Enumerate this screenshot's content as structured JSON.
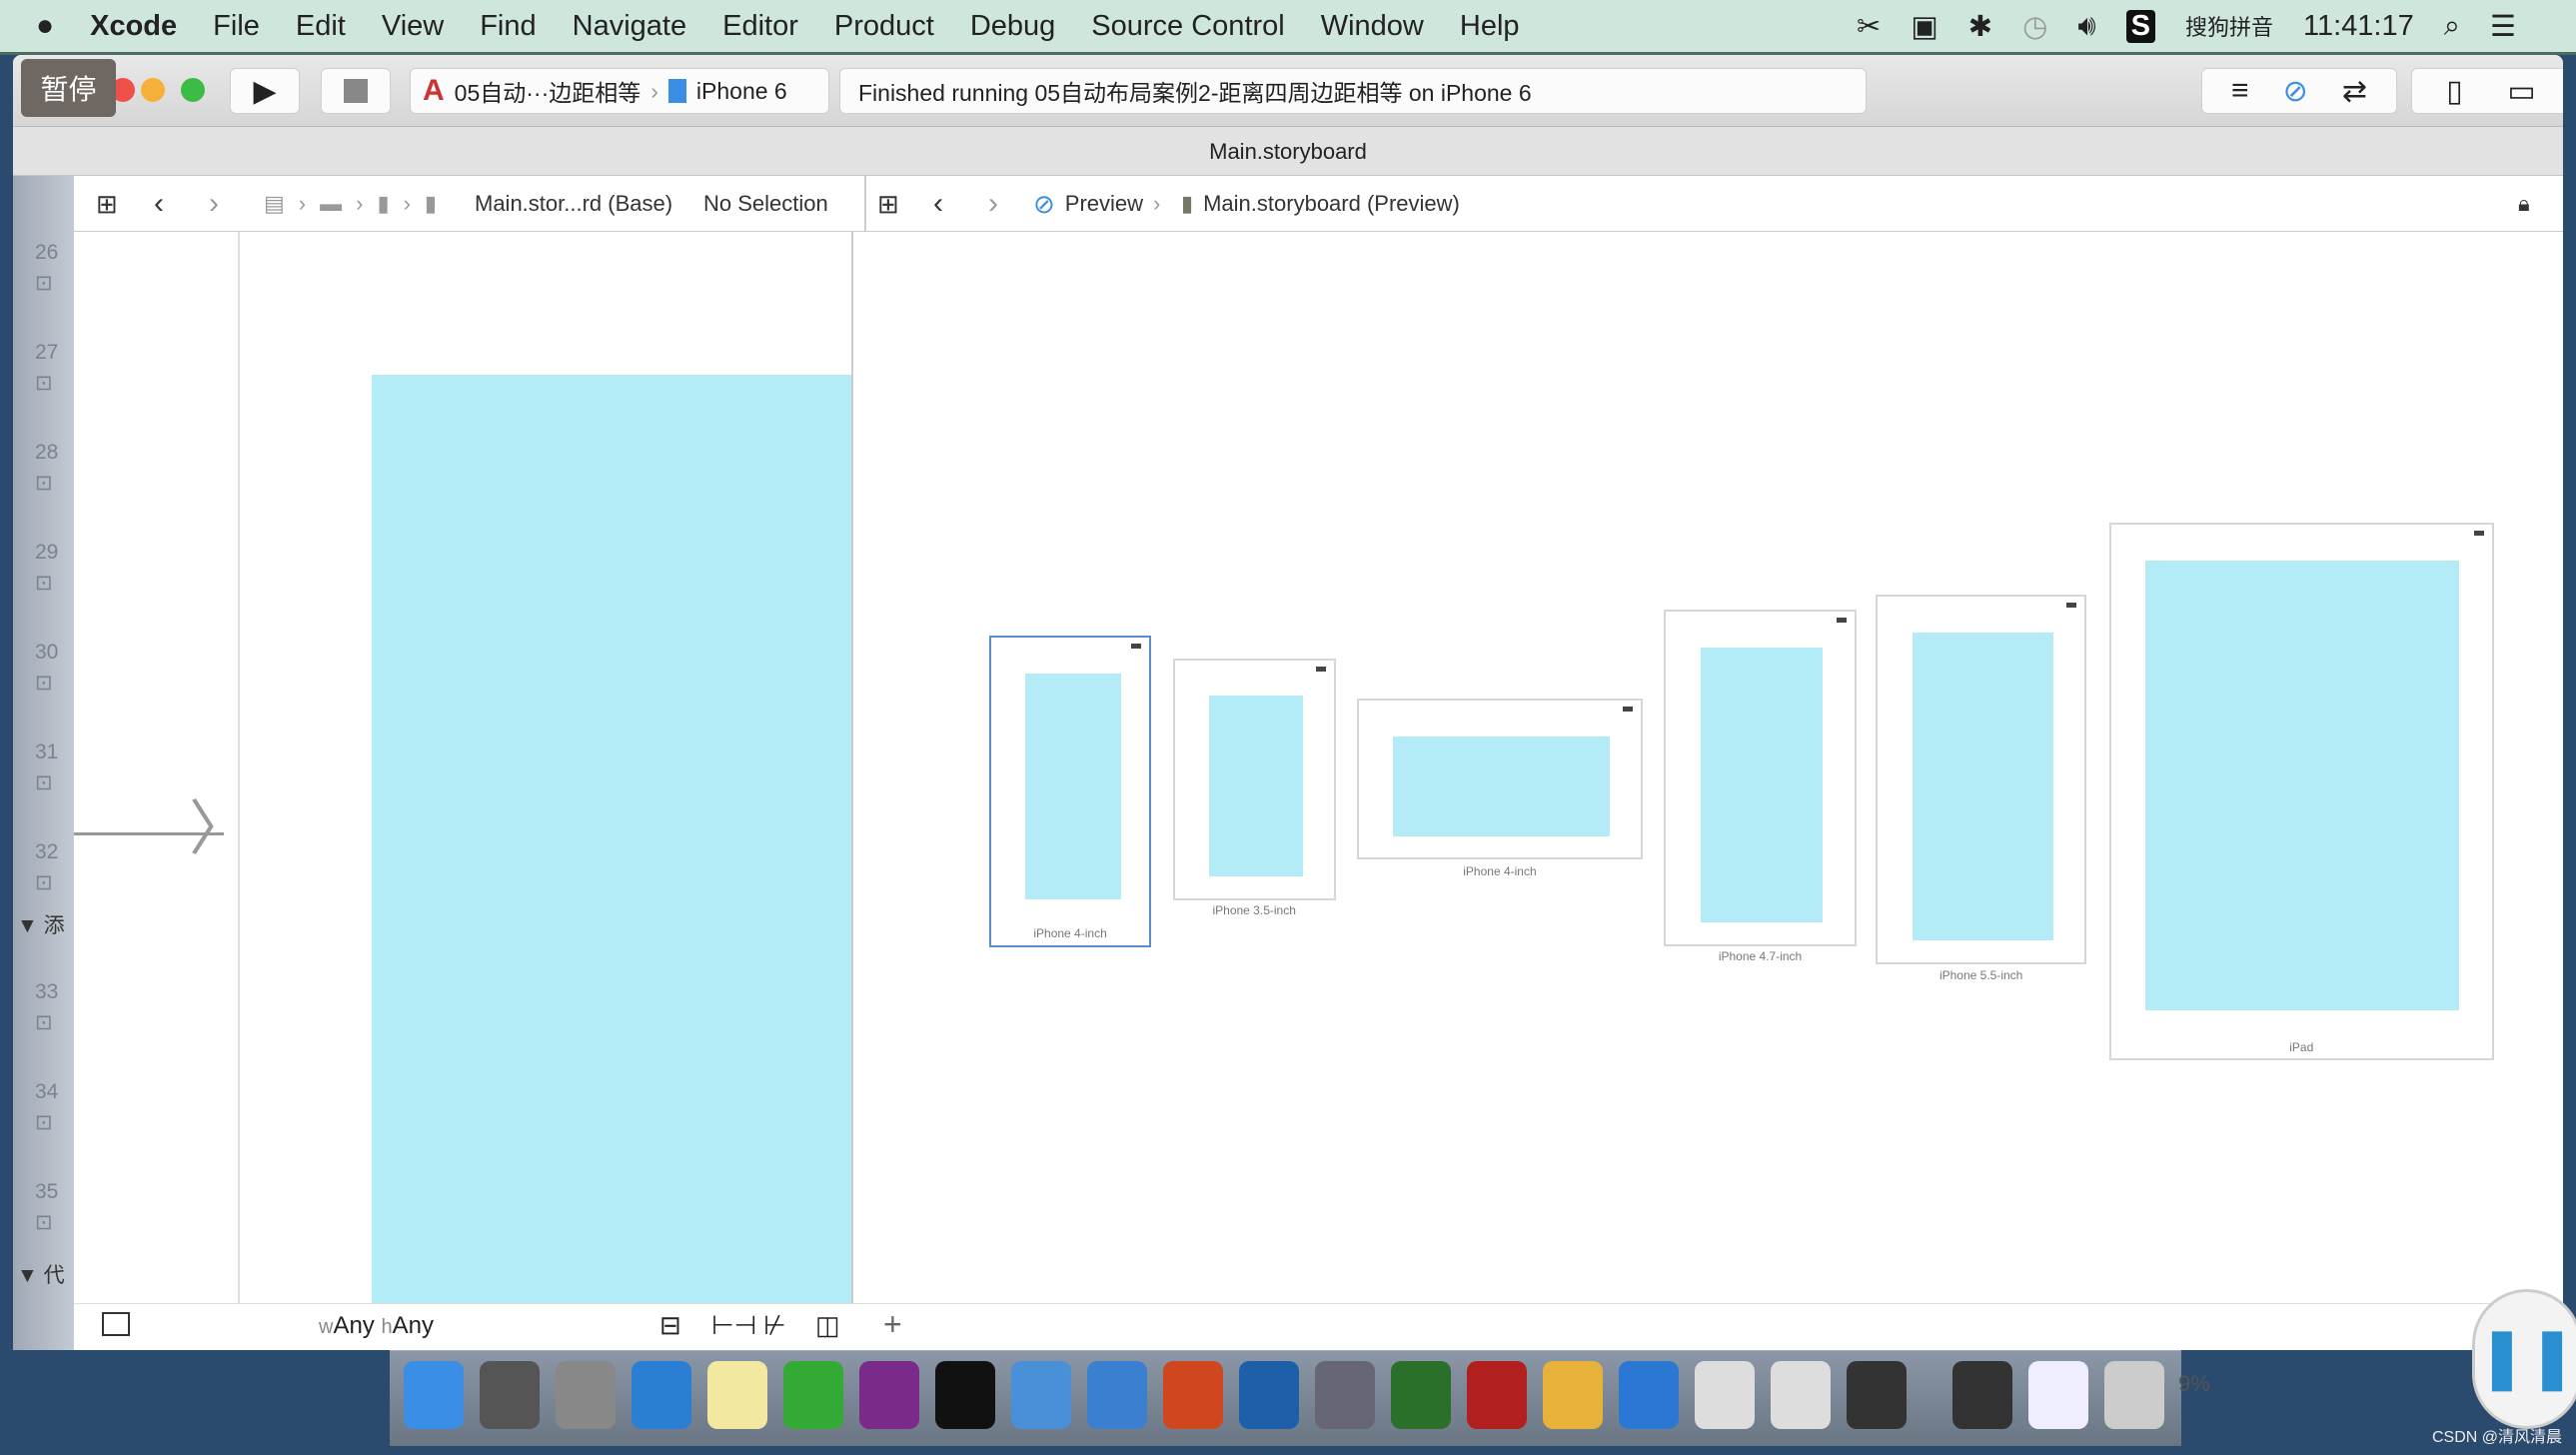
{
  "menubar": {
    "items": [
      "Xcode",
      "File",
      "Edit",
      "View",
      "Find",
      "Navigate",
      "Editor",
      "Product",
      "Debug",
      "Source Control",
      "Window",
      "Help"
    ],
    "input_method": "搜狗拼音",
    "clock": "11:41:17",
    "icons": [
      "apple-icon",
      "scissors-icon",
      "screen-record-icon",
      "bluetooth-icon",
      "time-machine-icon",
      "volume-icon",
      "sogou-icon",
      "spotlight-icon",
      "notification-list-icon"
    ]
  },
  "toolbar": {
    "pause_overlay": "暂停",
    "scheme": "05自动···边距相等",
    "device": "iPhone 6",
    "status": "Finished running 05自动布局案例2-距离四周边距相等 on iPhone 6"
  },
  "titlebar": {
    "title": "Main.storyboard"
  },
  "jumpbar_left": {
    "file": "Main.stor...rd (Base)",
    "selection": "No Selection"
  },
  "jumpbar_right": {
    "mode": "Preview",
    "file": "Main.storyboard (Preview)"
  },
  "gutter": {
    "lines": [
      "26",
      "27",
      "28",
      "29",
      "30",
      "31",
      "32",
      "33",
      "34",
      "35"
    ],
    "group1": "▼ 添",
    "group2": "▼ 代"
  },
  "bottombar": {
    "w_prefix": "w",
    "w_value": "Any",
    "h_prefix": "h",
    "h_value": "Any",
    "add": "+"
  },
  "previews": [
    {
      "label": "iPhone 4-inch",
      "selected": true
    },
    {
      "label": "iPhone 3.5-inch"
    },
    {
      "label": "iPhone 4-inch",
      "landscape": true
    },
    {
      "label": "iPhone 4.7-inch"
    },
    {
      "label": "iPhone 5.5-inch"
    },
    {
      "label": "iPad"
    }
  ],
  "colors": {
    "view_background": "#b3ecf7",
    "menubar": "#cfe6dc"
  },
  "dock": {
    "zoom_partial": "9%"
  },
  "watermark": "CSDN @清风清晨"
}
